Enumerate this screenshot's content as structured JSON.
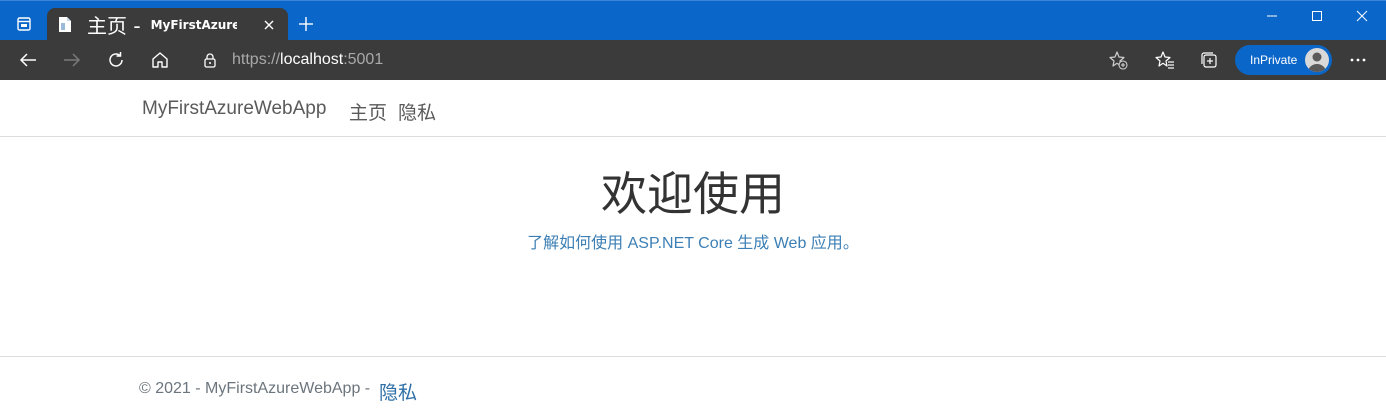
{
  "browser": {
    "tab": {
      "title_main": "主页 -",
      "title_small": "MyFirstAzureWebA"
    },
    "address": {
      "scheme": "https://",
      "host": "localhost",
      "port": ":5001"
    },
    "inprivate_label": "InPrivate",
    "colors": {
      "titlebar": "#0a66c9",
      "toolbar": "#3b3b3b",
      "accent": "#0a66c9"
    },
    "icons": [
      "tab-actions-icon",
      "page-icon",
      "close-icon",
      "new-tab-icon",
      "minimize-icon",
      "maximize-icon",
      "window-close-icon",
      "back-icon",
      "forward-icon",
      "refresh-icon",
      "home-icon",
      "lock-icon",
      "add-favorite-icon",
      "favorites-icon",
      "collections-icon",
      "more-icon"
    ]
  },
  "page": {
    "navbar": {
      "brand": "MyFirstAzureWebApp",
      "links": [
        "主页",
        "隐私"
      ]
    },
    "main": {
      "heading": "欢迎使用",
      "learn_prefix": "了解如何",
      "learn_link": "使用 ASP.NET Core 生成 Web 应用",
      "learn_suffix": "。"
    },
    "footer": {
      "copyright": "© 2021 - MyFirstAzureWebApp -",
      "privacy_link": "隐私"
    }
  }
}
